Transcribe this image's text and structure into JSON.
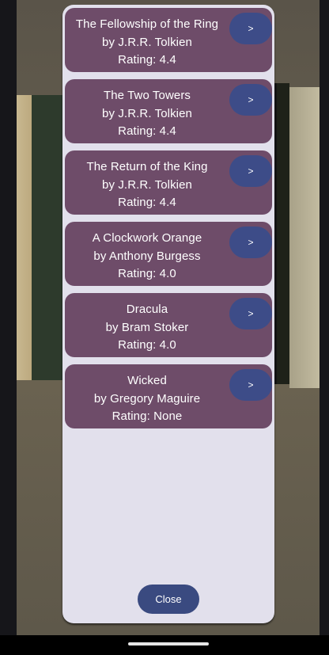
{
  "books": [
    {
      "title": "The Fellowship of the Ring",
      "author": "by J.R.R. Tolkien",
      "rating": "Rating: 4.4",
      "open_label": ">"
    },
    {
      "title": "The Two Towers",
      "author": "by J.R.R. Tolkien",
      "rating": "Rating: 4.4",
      "open_label": ">"
    },
    {
      "title": "The Return of the King",
      "author": "by J.R.R. Tolkien",
      "rating": "Rating: 4.4",
      "open_label": ">"
    },
    {
      "title": "A Clockwork Orange",
      "author": "by Anthony Burgess",
      "rating": "Rating: 4.0",
      "open_label": ">"
    },
    {
      "title": "Dracula",
      "author": "by Bram Stoker",
      "rating": "Rating: 4.0",
      "open_label": ">"
    },
    {
      "title": "Wicked",
      "author": "by Gregory Maguire",
      "rating": "Rating: None",
      "open_label": ">"
    }
  ],
  "close_label": "Close",
  "colors": {
    "card": "#6e4c69",
    "button": "#3d4c88",
    "sheet": "#e2e0ec"
  }
}
